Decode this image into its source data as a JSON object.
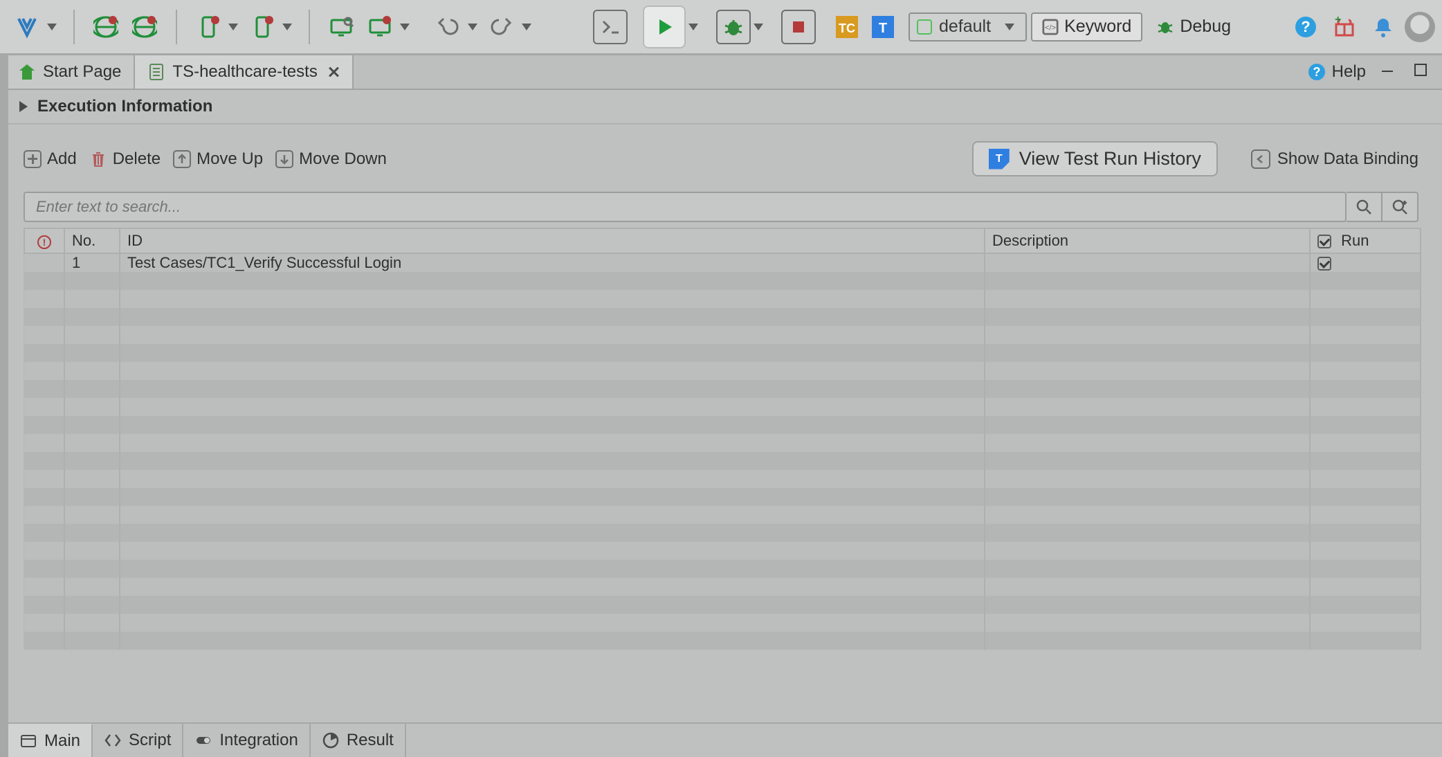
{
  "toolbar": {
    "profile_dropdown": {
      "label": "default"
    },
    "keyword_toggle": "Keyword",
    "debug_toggle": "Debug"
  },
  "tabs": {
    "start_page": "Start Page",
    "active": {
      "title": "TS-healthcare-tests"
    },
    "help": "Help"
  },
  "exec_info": {
    "title": "Execution Information"
  },
  "list_toolbar": {
    "add": "Add",
    "delete": "Delete",
    "move_up": "Move Up",
    "move_down": "Move Down",
    "view_history": "View Test Run History",
    "show_binding": "Show Data Binding"
  },
  "search": {
    "placeholder": "Enter text to search..."
  },
  "table": {
    "headers": {
      "no": "No.",
      "id": "ID",
      "desc": "Description",
      "run": "Run"
    },
    "rows": [
      {
        "no": "1",
        "id": "Test Cases/TC1_Verify Successful Login",
        "desc": "",
        "run": true
      }
    ]
  },
  "bottom_tabs": {
    "main": "Main",
    "script": "Script",
    "integration": "Integration",
    "result": "Result"
  }
}
